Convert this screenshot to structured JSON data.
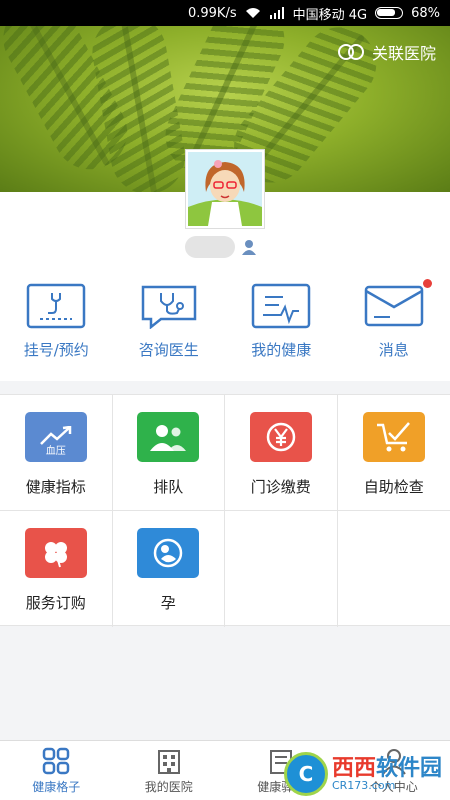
{
  "statusbar": {
    "network_speed": "0.99K/s",
    "carrier": "中国移动 4G",
    "battery": "68%"
  },
  "banner": {
    "link_label": "关联医院"
  },
  "profile": {
    "username": "",
    "avatar": "cartoon-girl-avatar"
  },
  "quick_actions": [
    {
      "label": "挂号/预约",
      "icon": "registration-icon"
    },
    {
      "label": "咨询医生",
      "icon": "stethoscope-chat-icon"
    },
    {
      "label": "我的健康",
      "icon": "health-card-icon"
    },
    {
      "label": "消息",
      "icon": "envelope-icon",
      "badge": true
    }
  ],
  "services": [
    {
      "label": "健康指标",
      "tile_text": "血压",
      "color": "#5b8ad1",
      "icon": "trend-chart-icon"
    },
    {
      "label": "排队",
      "tile_text": "",
      "color": "#2fb24b",
      "icon": "people-queue-icon"
    },
    {
      "label": "门诊缴费",
      "tile_text": "",
      "color": "#e8534a",
      "icon": "yen-coin-icon"
    },
    {
      "label": "自助检查",
      "tile_text": "",
      "color": "#f0a028",
      "icon": "cart-check-icon"
    },
    {
      "label": "服务订购",
      "tile_text": "",
      "color": "#e8534a",
      "icon": "clover-icon"
    },
    {
      "label": "孕",
      "tile_text": "",
      "color": "#2f8ad8",
      "icon": "baby-icon"
    }
  ],
  "tabbar": [
    {
      "label": "健康格子",
      "icon": "grid-icon",
      "active": true
    },
    {
      "label": "我的医院",
      "icon": "hospital-icon",
      "active": false
    },
    {
      "label": "健康驿站",
      "icon": "station-icon",
      "active": false
    },
    {
      "label": "个人中心",
      "icon": "person-icon",
      "active": false
    }
  ],
  "watermark": {
    "logo_letter": "C",
    "text_main": "西西",
    "text_soft": "软件园",
    "text_url": "CR173.com"
  },
  "colors": {
    "accent": "#3a78c3",
    "badge": "#e8403a"
  }
}
